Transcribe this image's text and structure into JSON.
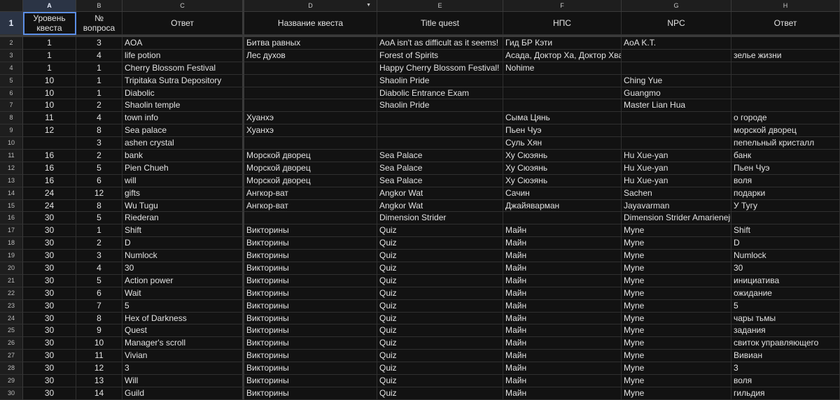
{
  "columns": [
    "",
    "A",
    "B",
    "C",
    "D",
    "E",
    "F",
    "G",
    "H"
  ],
  "header_row": {
    "num": "1",
    "cells": [
      "Уровень квеста",
      "№ вопроса",
      "Ответ",
      "Название квеста",
      "Title quest",
      "НПС",
      "NPC",
      "Ответ"
    ]
  },
  "rows": [
    {
      "num": "2",
      "cells": [
        "1",
        "3",
        "AOA",
        "Битва равных",
        "AoA isn't as difficult as it seems!",
        "Гид БР Кэти",
        "AoA K.T.",
        ""
      ]
    },
    {
      "num": "3",
      "cells": [
        "1",
        "4",
        "life potion",
        "Лес духов",
        "Forest of Spirits",
        "Асада, Доктор Ха, Доктор Хван",
        "",
        "зелье жизни"
      ]
    },
    {
      "num": "4",
      "cells": [
        "1",
        "1",
        "Cherry Blossom Festival",
        "",
        "Happy Cherry Blossom Festival!",
        "Nohime",
        "",
        ""
      ]
    },
    {
      "num": "5",
      "cells": [
        "10",
        "1",
        "Tripitaka Sutra Depository",
        "",
        "Shaolin Pride",
        "",
        "Ching Yue",
        ""
      ]
    },
    {
      "num": "6",
      "cells": [
        "10",
        "1",
        "Diabolic",
        "",
        "Diabolic Entrance Exam",
        "",
        "Guangmo",
        ""
      ]
    },
    {
      "num": "7",
      "cells": [
        "10",
        "2",
        "Shaolin temple",
        "",
        "Shaolin Pride",
        "",
        "Master Lian Hua",
        ""
      ]
    },
    {
      "num": "8",
      "cells": [
        "11",
        "4",
        "town info",
        "Хуанхэ",
        "",
        "Сыма Цянь",
        "",
        "о городе"
      ]
    },
    {
      "num": "9",
      "cells": [
        "12",
        "8",
        "Sea palace",
        "Хуанхэ",
        "",
        "Пьен Чуэ",
        "",
        "морской дворец"
      ]
    },
    {
      "num": "10",
      "cells": [
        "",
        "3",
        "ashen crystal",
        "",
        "",
        "Суль Хян",
        "",
        "пепельный кристалл"
      ]
    },
    {
      "num": "11",
      "cells": [
        "16",
        "2",
        "bank",
        "Морской дворец",
        "Sea Palace",
        "Ху Сюэянь",
        "Hu Xue-yan",
        "банк"
      ]
    },
    {
      "num": "12",
      "cells": [
        "16",
        "5",
        "Pien Chueh",
        "Морской дворец",
        "Sea Palace",
        "Ху Сюэянь",
        "Hu Xue-yan",
        "Пьен Чуэ"
      ]
    },
    {
      "num": "13",
      "cells": [
        "16",
        "6",
        "will",
        "Морской дворец",
        "Sea Palace",
        "Ху Сюэянь",
        "Hu Xue-yan",
        "воля"
      ]
    },
    {
      "num": "14",
      "cells": [
        "24",
        "12",
        "gifts",
        "Ангкор-ват",
        "Angkor Wat",
        "Сачин",
        "Sachen",
        "подарки"
      ]
    },
    {
      "num": "15",
      "cells": [
        "24",
        "8",
        "Wu Tugu",
        "Ангкор-ват",
        "Angkor Wat",
        "Джайяварман",
        "Jayavarman",
        "У Тугу"
      ]
    },
    {
      "num": "16",
      "cells": [
        "30",
        "5",
        "Riederan",
        "",
        "Dimension Strider",
        "",
        "Dimension Strider Amarieneju",
        ""
      ]
    },
    {
      "num": "17",
      "cells": [
        "30",
        "1",
        "Shift",
        "Викторины",
        "Quiz",
        "Майн",
        "Myne",
        "Shift"
      ]
    },
    {
      "num": "18",
      "cells": [
        "30",
        "2",
        "D",
        "Викторины",
        "Quiz",
        "Майн",
        "Myne",
        "D"
      ]
    },
    {
      "num": "19",
      "cells": [
        "30",
        "3",
        "Numlock",
        "Викторины",
        "Quiz",
        "Майн",
        "Myne",
        "Numlock"
      ]
    },
    {
      "num": "20",
      "cells": [
        "30",
        "4",
        "30",
        "Викторины",
        "Quiz",
        "Майн",
        "Myne",
        "30"
      ]
    },
    {
      "num": "21",
      "cells": [
        "30",
        "5",
        "Action power",
        "Викторины",
        "Quiz",
        "Майн",
        "Myne",
        "инициатива"
      ]
    },
    {
      "num": "22",
      "cells": [
        "30",
        "6",
        "Wait",
        "Викторины",
        "Quiz",
        "Майн",
        "Myne",
        "ожидание"
      ]
    },
    {
      "num": "23",
      "cells": [
        "30",
        "7",
        "5",
        "Викторины",
        "Quiz",
        "Майн",
        "Myne",
        "5"
      ]
    },
    {
      "num": "24",
      "cells": [
        "30",
        "8",
        "Hex of Darkness",
        "Викторины",
        "Quiz",
        "Майн",
        "Myne",
        "чары тьмы"
      ]
    },
    {
      "num": "25",
      "cells": [
        "30",
        "9",
        "Quest",
        "Викторины",
        "Quiz",
        "Майн",
        "Myne",
        "задания"
      ]
    },
    {
      "num": "26",
      "cells": [
        "30",
        "10",
        "Manager's scroll",
        "Викторины",
        "Quiz",
        "Майн",
        "Myne",
        "свиток управляющего"
      ]
    },
    {
      "num": "27",
      "cells": [
        "30",
        "11",
        "Vivian",
        "Викторины",
        "Quiz",
        "Майн",
        "Myne",
        "Вивиан"
      ]
    },
    {
      "num": "28",
      "cells": [
        "30",
        "12",
        "3",
        "Викторины",
        "Quiz",
        "Майн",
        "Myne",
        "3"
      ]
    },
    {
      "num": "29",
      "cells": [
        "30",
        "13",
        "Will",
        "Викторины",
        "Quiz",
        "Майн",
        "Myne",
        "воля"
      ]
    },
    {
      "num": "30",
      "cells": [
        "30",
        "14",
        "Guild",
        "Викторины",
        "Quiz",
        "Майн",
        "Myne",
        "гильдия"
      ]
    }
  ],
  "icons": {
    "column_d_filter": "dropdown-arrow-icon"
  },
  "colors": {
    "background": "#121212",
    "grid": "#303030",
    "selection": "#5b8ee6"
  }
}
